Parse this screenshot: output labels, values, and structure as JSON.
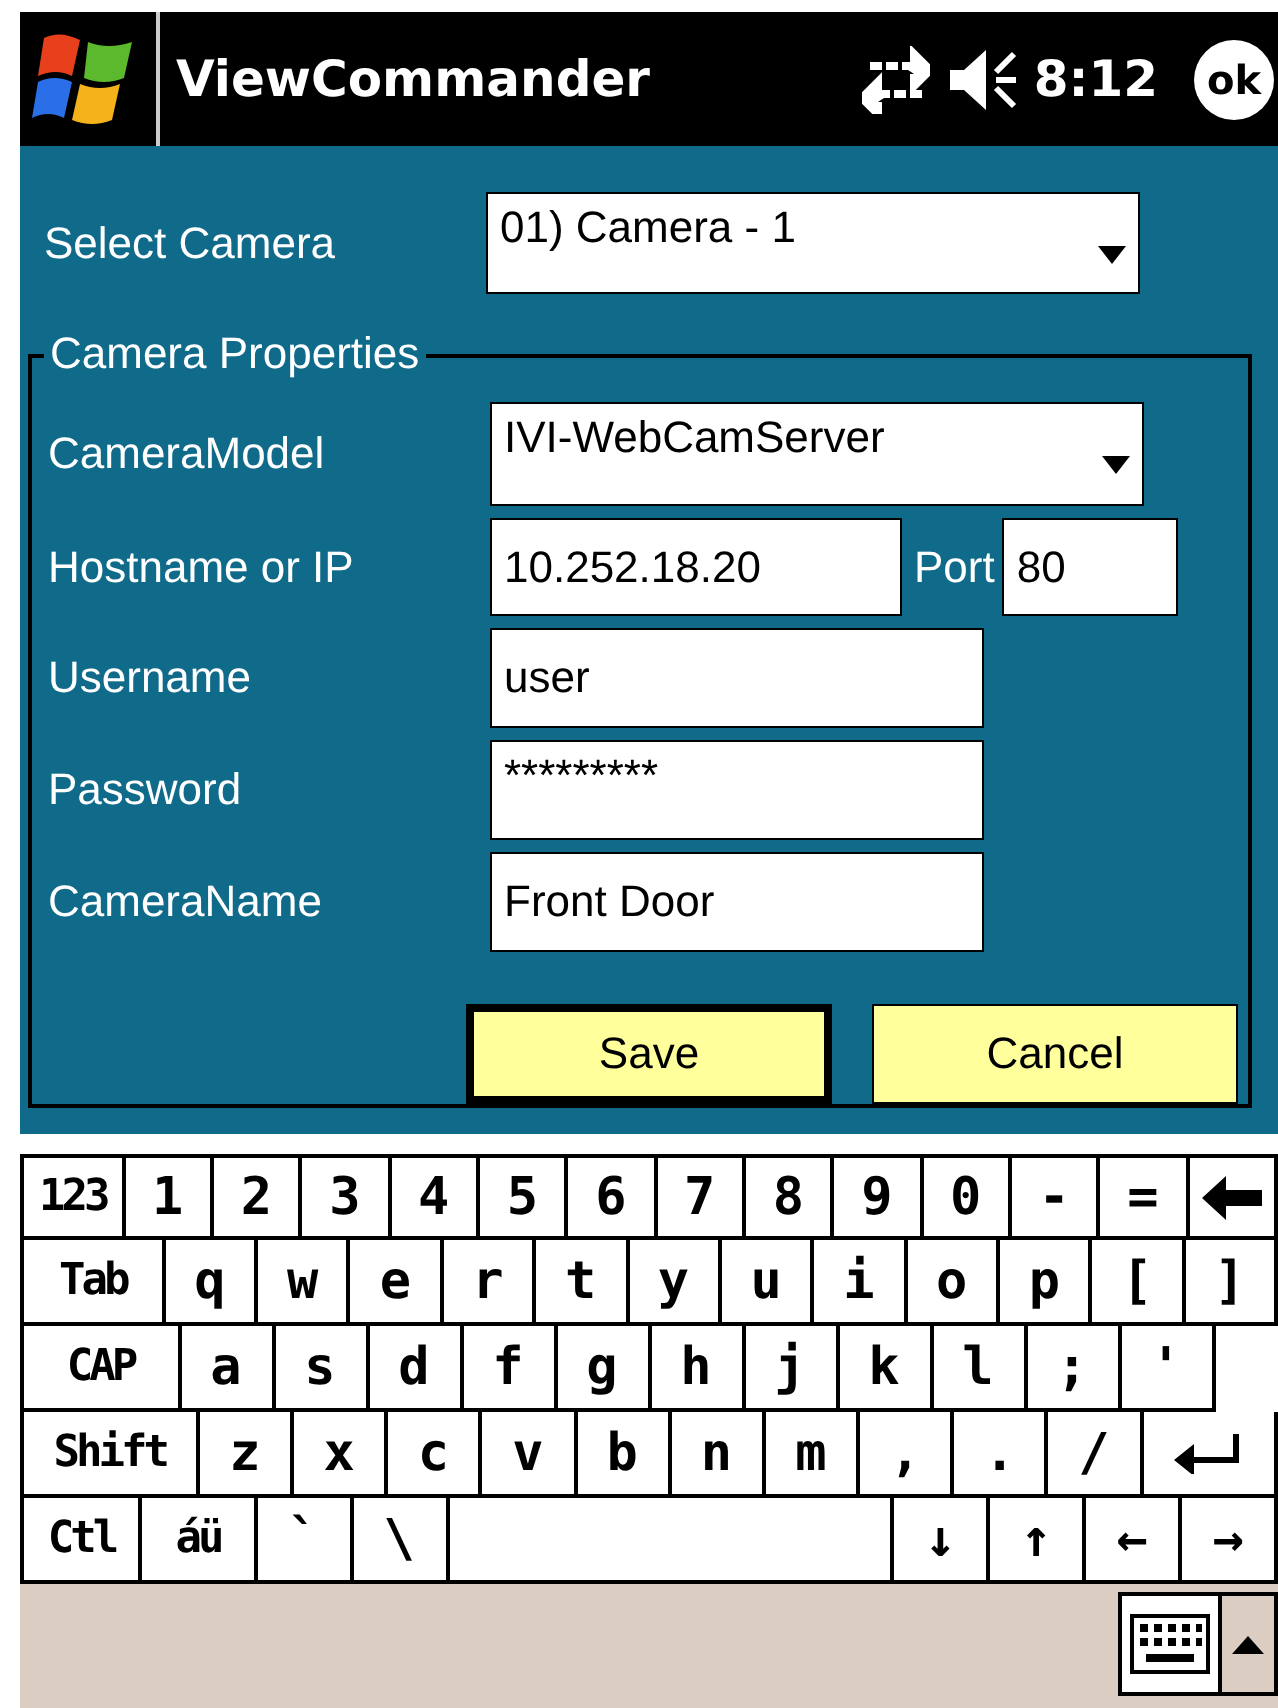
{
  "title_bar": {
    "title": "ViewCommander",
    "time": "8:12",
    "ok_button": "ok"
  },
  "select_camera": {
    "label": "Select Camera",
    "value": "01) Camera - 1"
  },
  "camera_properties": {
    "legend": "Camera Properties",
    "fields": [
      {
        "kind": "dropdown",
        "label": "CameraModel",
        "value": "IVI-WebCamServer"
      },
      {
        "kind": "host",
        "label": "Hostname or IP",
        "value": "10.252.18.20",
        "port_label": "Port",
        "port_value": "80"
      },
      {
        "kind": "text",
        "label": "Username",
        "value": "user"
      },
      {
        "kind": "text",
        "label": "Password",
        "value": "*********"
      },
      {
        "kind": "text",
        "label": "CameraName",
        "value": "Front Door"
      }
    ],
    "buttons": [
      {
        "label": "Save",
        "default": true
      },
      {
        "label": "Cancel",
        "default": false
      }
    ]
  },
  "keyboard": {
    "key_rows": [
      {
        "keys": [
          {
            "kind": "mod",
            "label": "123"
          },
          {
            "kind": "key",
            "label": "1"
          },
          {
            "kind": "key",
            "label": "2"
          },
          {
            "kind": "key",
            "label": "3"
          },
          {
            "kind": "key",
            "label": "4"
          },
          {
            "kind": "key",
            "label": "5"
          },
          {
            "kind": "key",
            "label": "6"
          },
          {
            "kind": "key",
            "label": "7"
          },
          {
            "kind": "key",
            "label": "8"
          },
          {
            "kind": "key",
            "label": "9"
          },
          {
            "kind": "key",
            "label": "0"
          },
          {
            "kind": "key",
            "label": "-"
          },
          {
            "kind": "key",
            "label": "="
          },
          {
            "kind": "backspace"
          }
        ]
      },
      {
        "keys": [
          {
            "kind": "mod",
            "label": "Tab"
          },
          {
            "kind": "key",
            "label": "q"
          },
          {
            "kind": "key",
            "label": "w"
          },
          {
            "kind": "key",
            "label": "e"
          },
          {
            "kind": "key",
            "label": "r"
          },
          {
            "kind": "key",
            "label": "t"
          },
          {
            "kind": "key",
            "label": "y"
          },
          {
            "kind": "key",
            "label": "u"
          },
          {
            "kind": "key",
            "label": "i"
          },
          {
            "kind": "key",
            "label": "o"
          },
          {
            "kind": "key",
            "label": "p"
          },
          {
            "kind": "key",
            "label": "["
          },
          {
            "kind": "key",
            "label": "]"
          }
        ]
      },
      {
        "keys": [
          {
            "kind": "mod",
            "label": "CAP"
          },
          {
            "kind": "key",
            "label": "a"
          },
          {
            "kind": "key",
            "label": "s"
          },
          {
            "kind": "key",
            "label": "d"
          },
          {
            "kind": "key",
            "label": "f"
          },
          {
            "kind": "key",
            "label": "g"
          },
          {
            "kind": "key",
            "label": "h"
          },
          {
            "kind": "key",
            "label": "j"
          },
          {
            "kind": "key",
            "label": "k"
          },
          {
            "kind": "key",
            "label": "l"
          },
          {
            "kind": "key",
            "label": ";"
          },
          {
            "kind": "key",
            "label": "'"
          },
          {
            "kind": "gap"
          }
        ]
      },
      {
        "keys": [
          {
            "kind": "mod",
            "label": "Shift"
          },
          {
            "kind": "key",
            "label": "z"
          },
          {
            "kind": "key",
            "label": "x"
          },
          {
            "kind": "key",
            "label": "c"
          },
          {
            "kind": "key",
            "label": "v"
          },
          {
            "kind": "key",
            "label": "b"
          },
          {
            "kind": "key",
            "label": "n"
          },
          {
            "kind": "key",
            "label": "m"
          },
          {
            "kind": "key",
            "label": ","
          },
          {
            "kind": "key",
            "label": "."
          },
          {
            "kind": "key",
            "label": "/"
          },
          {
            "kind": "enter"
          }
        ]
      },
      {
        "keys": [
          {
            "kind": "mod",
            "label": "Ctl"
          },
          {
            "kind": "mod",
            "label": "áü"
          },
          {
            "kind": "key",
            "label": "`"
          },
          {
            "kind": "key",
            "label": "\\"
          },
          {
            "kind": "space"
          },
          {
            "kind": "key",
            "label": "↓"
          },
          {
            "kind": "key",
            "label": "↑"
          },
          {
            "kind": "key",
            "label": "←"
          },
          {
            "kind": "key",
            "label": "→"
          }
        ]
      }
    ]
  }
}
